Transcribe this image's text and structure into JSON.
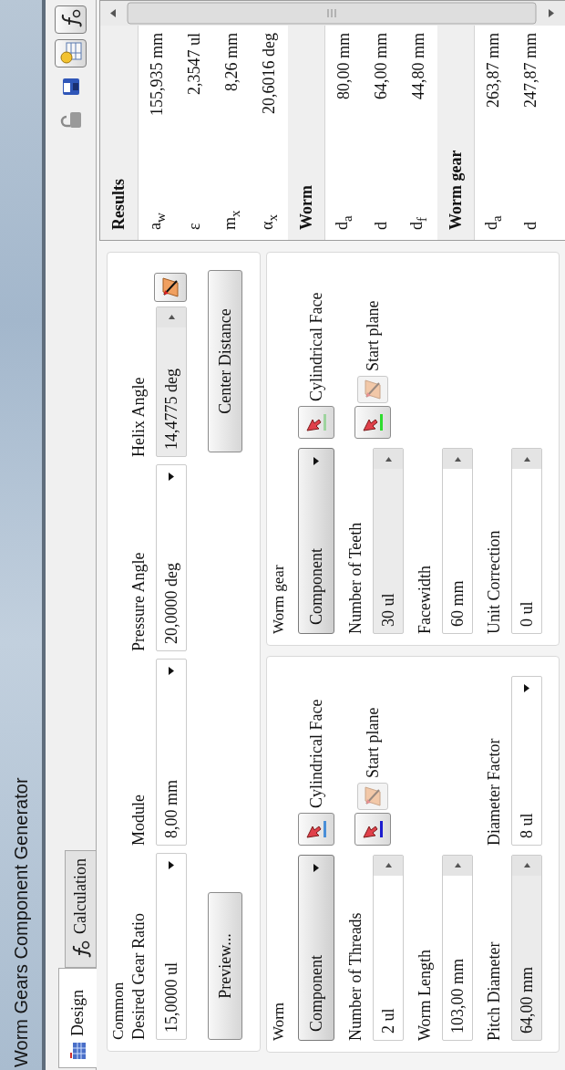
{
  "window": {
    "title": "Worm Gears Component Generator"
  },
  "tabs": [
    {
      "label": "Design",
      "selected": true
    },
    {
      "label": "Calculation",
      "selected": false
    }
  ],
  "toolbar": [
    {
      "kind": "lock",
      "pressed": false
    },
    {
      "kind": "save",
      "pressed": false
    },
    {
      "kind": "table",
      "pressed": true
    },
    {
      "kind": "function",
      "pressed": true
    }
  ],
  "common": {
    "title": "Common",
    "fields": [
      {
        "label": "Desired Gear Ratio",
        "value": "15,0000 ul",
        "kind": "dropdown",
        "disabled": false
      },
      {
        "label": "Module",
        "value": "8,00 mm",
        "kind": "dropdown",
        "disabled": false
      },
      {
        "label": "Pressure Angle",
        "value": "20,0000 deg",
        "kind": "dropdown",
        "disabled": false
      },
      {
        "label": "Helix Angle",
        "value": "14,4775 deg",
        "kind": "spinner",
        "disabled": true
      }
    ],
    "buttons": [
      {
        "label": "Preview..."
      },
      {
        "label": "Center Distance"
      }
    ]
  },
  "parts": [
    {
      "title": "Worm",
      "component": "Component",
      "references": [
        {
          "kind": "face",
          "label": "Cylindrical Face",
          "color": "#4a8fd8"
        },
        {
          "kind": "plane",
          "label": "Start plane",
          "color": "#1c1ccf"
        }
      ],
      "fields": [
        {
          "label": "Number of Threads",
          "value": "2 ul",
          "kind": "spinner",
          "disabled": false
        },
        {
          "label": "Worm Length",
          "value": "103,00 mm",
          "kind": "spinner",
          "disabled": false
        },
        {
          "label": "Pitch Diameter",
          "value": "64,00 mm",
          "kind": "spinner",
          "disabled": true
        },
        {
          "label": "Diameter Factor",
          "value": "8 ul",
          "kind": "dropdown",
          "disabled": false
        }
      ]
    },
    {
      "title": "Worm gear",
      "component": "Component",
      "references": [
        {
          "kind": "face",
          "label": "Cylindrical Face",
          "color": "#9fd49f"
        },
        {
          "kind": "plane",
          "label": "Start plane",
          "color": "#2edc2e"
        }
      ],
      "fields": [
        {
          "label": "Number of Teeth",
          "value": "30 ul",
          "kind": "spinner",
          "disabled": true
        },
        {
          "label": "Facewidth",
          "value": "60 mm",
          "kind": "spinner",
          "disabled": false
        },
        {
          "label": "Unit Correction",
          "value": "0 ul",
          "kind": "spinner",
          "disabled": false
        }
      ]
    }
  ],
  "results": {
    "title": "Results",
    "rows": [
      {
        "kind": "value",
        "symbol": "a$_{w}$",
        "value": "155,935 mm"
      },
      {
        "kind": "value",
        "symbol": "ε",
        "value": "2,3547 ul"
      },
      {
        "kind": "value",
        "symbol": "m$_{x}$",
        "value": "8,26 mm"
      },
      {
        "kind": "value",
        "symbol": "α$_{x}$",
        "value": "20,6016 deg"
      },
      {
        "kind": "header",
        "label": "Worm"
      },
      {
        "kind": "value",
        "symbol": "d$_{a}$",
        "value": "80,00 mm"
      },
      {
        "kind": "value",
        "symbol": "d",
        "value": "64,00 mm"
      },
      {
        "kind": "value",
        "symbol": "d$_{f}$",
        "value": "44,80 mm"
      },
      {
        "kind": "header",
        "label": "Worm gear"
      },
      {
        "kind": "value",
        "symbol": "d$_{a}$",
        "value": "263,87 mm"
      },
      {
        "kind": "value",
        "symbol": "d",
        "value": "247,87 mm"
      }
    ]
  }
}
